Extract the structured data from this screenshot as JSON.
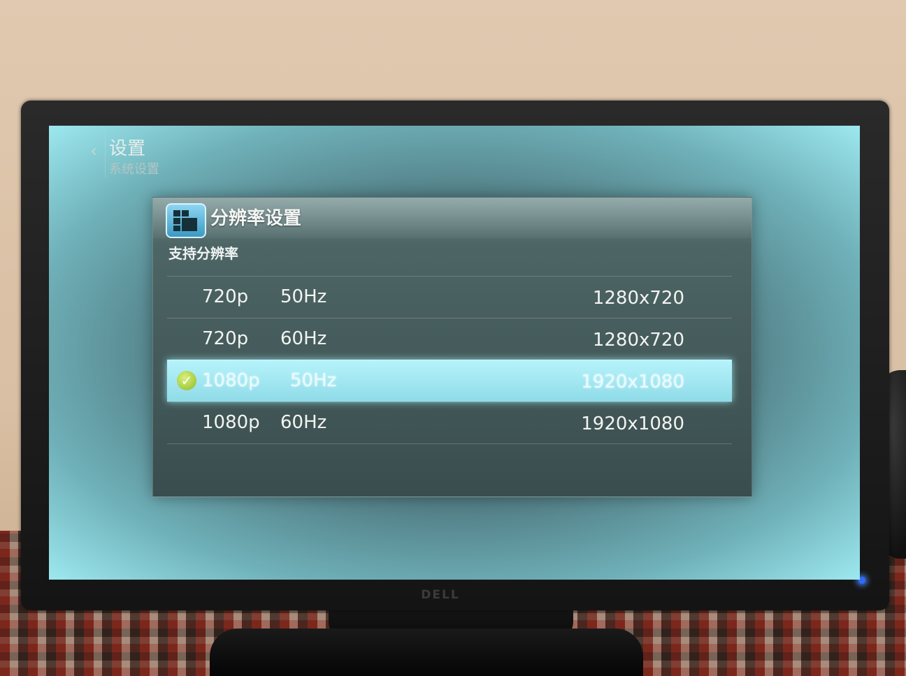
{
  "header": {
    "back_icon": "chevron-left-icon",
    "title": "设置",
    "subtitle": "系统设置"
  },
  "panel": {
    "icon": "resolution-grid-icon",
    "title": "分辨率设置",
    "section_label": "支持分辨率",
    "rows": [
      {
        "resolution": "720p",
        "refresh": "50Hz",
        "dimensions": "1280x720",
        "selected": false
      },
      {
        "resolution": "720p",
        "refresh": "60Hz",
        "dimensions": "1280x720",
        "selected": false
      },
      {
        "resolution": "1080p",
        "refresh": "50Hz",
        "dimensions": "1920x1080",
        "selected": true
      },
      {
        "resolution": "1080p",
        "refresh": "60Hz",
        "dimensions": "1920x1080",
        "selected": false
      }
    ],
    "selected_indicator": "✓"
  },
  "monitor": {
    "brand": "DELL",
    "power_led_color": "#2d6bff"
  },
  "colors": {
    "highlight": "#9fe6f0",
    "screen_background": "#4a7077"
  }
}
